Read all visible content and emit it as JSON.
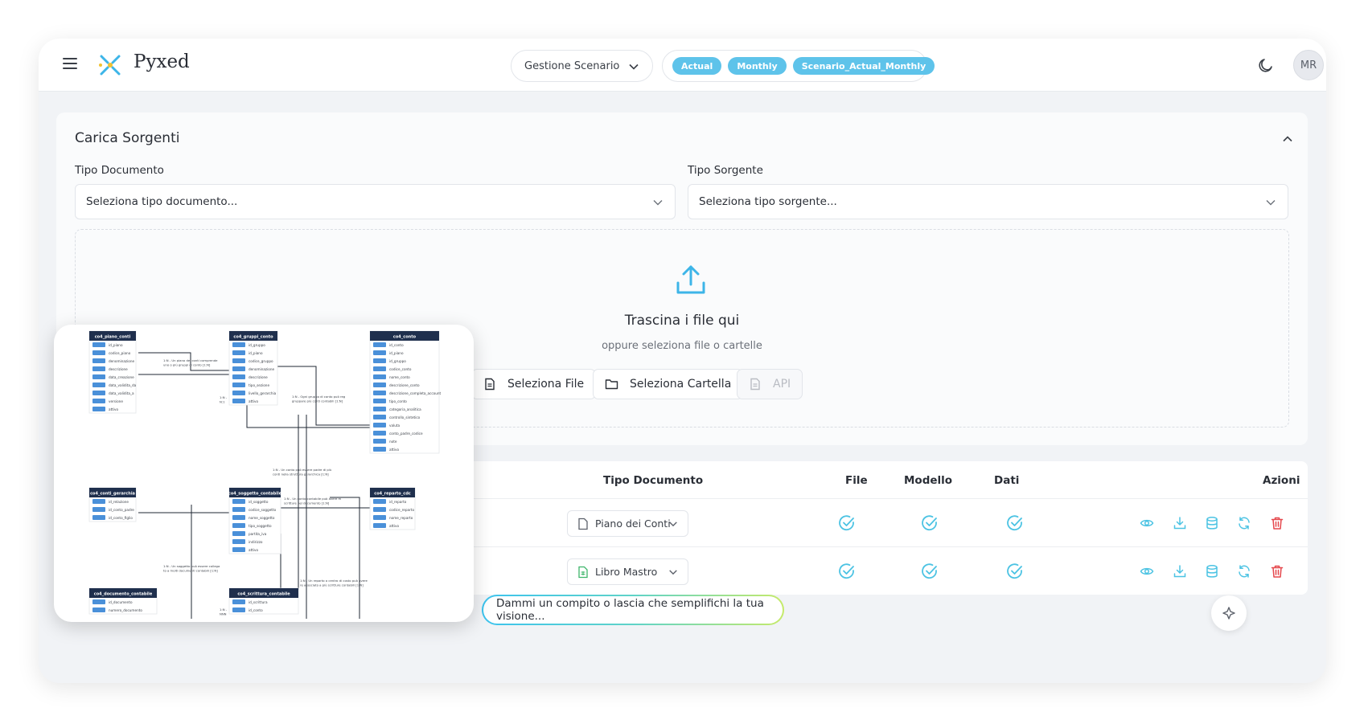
{
  "app": {
    "name": "Pyxed",
    "avatar_initials": "MR"
  },
  "header": {
    "scenario_select": "Gestione Scenario",
    "tags": [
      "Actual",
      "Monthly",
      "Scenario_Actual_Monthly"
    ]
  },
  "upload": {
    "title": "Carica Sorgenti",
    "doc_type_label": "Tipo Documento",
    "doc_type_placeholder": "Seleziona tipo documento...",
    "source_type_label": "Tipo Sorgente",
    "source_type_placeholder": "Seleziona tipo sorgente...",
    "drop_title": "Trascina i file qui",
    "drop_subtitle": "oppure seleziona file o cartelle",
    "btn_file": "Seleziona File",
    "btn_folder": "Seleziona Cartella",
    "btn_api": "API"
  },
  "table": {
    "columns": {
      "tipo": "Tipo Documento",
      "file": "File",
      "modello": "Modello",
      "dati": "Dati",
      "azioni": "Azioni"
    },
    "rows": [
      {
        "tipo": "Piano dei Conti",
        "file": true,
        "modello": true,
        "dati": true
      },
      {
        "tipo": "Libro Mastro",
        "file": true,
        "modello": true,
        "dati": true
      }
    ]
  },
  "erd": {
    "tables": [
      {
        "name": "co4_piano_conti",
        "fields": [
          "id_piano",
          "codice_piano",
          "denominazione",
          "descrizione",
          "data_creazione",
          "data_validita_da",
          "data_validita_a",
          "versione",
          "attivo"
        ]
      },
      {
        "name": "co4_gruppi_conto",
        "fields": [
          "id_gruppo",
          "id_piano",
          "codice_gruppo",
          "denominazione",
          "descrizione",
          "tipo_sezione",
          "livello_gerarchia",
          "attivo"
        ]
      },
      {
        "name": "co4_conto",
        "fields": [
          "id_conto",
          "id_piano",
          "id_gruppo",
          "codice_conto",
          "nome_conto",
          "descrizione_conto",
          "descrizione_completa_account",
          "tipo_conto",
          "categoria_analitica",
          "controllo_sintetico",
          "valuta",
          "conto_padre_codice",
          "note",
          "attivo"
        ]
      },
      {
        "name": "co4_conti_gerarchia",
        "fields": [
          "id_relazione",
          "id_conto_padre",
          "id_conto_figlio"
        ]
      },
      {
        "name": "co4_soggetto_contabile",
        "fields": [
          "id_soggetto",
          "codice_soggetto",
          "nome_soggetto",
          "tipo_soggetto",
          "partita_iva",
          "indirizzo",
          "attivo"
        ]
      },
      {
        "name": "co4_reparto_cdc",
        "fields": [
          "id_reparto",
          "codice_reparto",
          "nome_reparto",
          "attivo"
        ]
      },
      {
        "name": "co4_documento_contabile",
        "fields": [
          "id_documento",
          "numero_documento"
        ]
      },
      {
        "name": "co4_scrittura_contabile",
        "fields": [
          "id_scrittura",
          "id_conto"
        ]
      }
    ],
    "relations": [
      "1:N - Un piano dei conti comprende\nuno o più gruppi di conto [1:N]",
      "1:N - Ogni gruppo di conto può reg\ngruppare più conti contabili [1:N]",
      "1:N - Un conto può essere padre di più\nconti nella struttura gerarchica [1:N]",
      "1:N - Un conto contabile può avere m\nscritture nel documento [1:N]",
      "1:N - Un soggetto può essere collega\nto a molti documenti contabili [1:N]",
      "1:N - Un reparto o centro di costo può avere\nre associato a più scritture contabili [1:N]",
      "1:N -\nN:1",
      "1:N -\nNNN"
    ]
  },
  "assistant": {
    "placeholder": "Dammi un compito o lascia che semplifichi la tua visione..."
  }
}
